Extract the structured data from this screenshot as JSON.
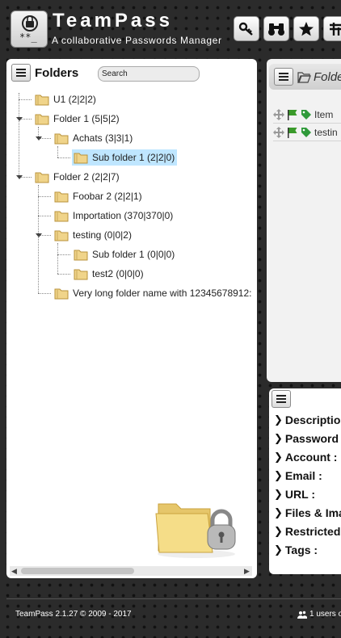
{
  "brand": {
    "title": "TeamPass",
    "subtitle": "A collaborative Passwords Manager"
  },
  "toolbar": {
    "buttons": [
      {
        "icon": "key-search-icon"
      },
      {
        "icon": "binoculars-icon"
      },
      {
        "icon": "star-icon"
      },
      {
        "icon": "settings-icon"
      }
    ]
  },
  "folders": {
    "title": "Folders",
    "search_placeholder": "Search",
    "nodes": [
      {
        "label": "U1 (2|2|2)"
      },
      {
        "label": "Folder 1 (5|5|2)"
      },
      {
        "label": "Achats (3|3|1)"
      },
      {
        "label": "Sub folder 1 (2|2|0)",
        "selected": true
      },
      {
        "label": "Folder 2 (2|2|7)"
      },
      {
        "label": "Foobar 2 (2|2|1)"
      },
      {
        "label": "Importation (370|370|0)"
      },
      {
        "label": "testing (0|0|2)"
      },
      {
        "label": "Sub folder 1 (0|0|0)"
      },
      {
        "label": "test2 (0|0|0)"
      },
      {
        "label": "Very long folder name with 12345678912:"
      }
    ]
  },
  "items_panel": {
    "title": "Folde",
    "rows": [
      {
        "label": "Item"
      },
      {
        "label": "testin"
      }
    ]
  },
  "details": {
    "fields": [
      {
        "label": "Descriptio"
      },
      {
        "label": "Password"
      },
      {
        "label": "Account :"
      },
      {
        "label": "Email :"
      },
      {
        "label": "URL :"
      },
      {
        "label": "Files & Ima"
      },
      {
        "label": "Restricted"
      },
      {
        "label": "Tags :"
      }
    ]
  },
  "footer": {
    "version": "TeamPass 2.1.27 © 2009 - 2017",
    "users": "1 users o"
  },
  "colors": {
    "selected_row": "#bfe6ff",
    "background": "#2b2b2b",
    "flag_green": "#3a9a2a"
  }
}
